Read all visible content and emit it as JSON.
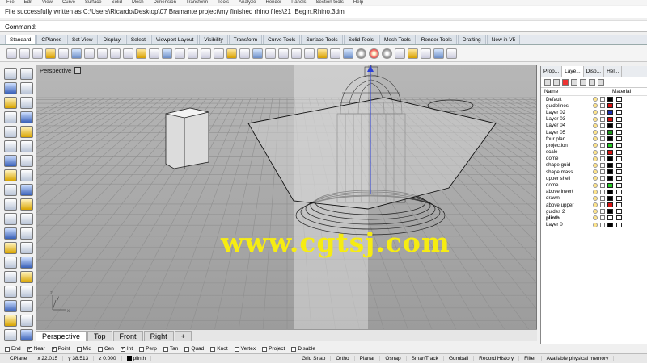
{
  "menu": {
    "items": [
      "File",
      "Edit",
      "View",
      "Curve",
      "Surface",
      "Solid",
      "Mesh",
      "Dimension",
      "Transform",
      "Tools",
      "Analyze",
      "Render",
      "Panels",
      "Section tools",
      "Help"
    ]
  },
  "status_line": "File successfully written as C:\\Users\\Ricardo\\Desktop\\07 Bramante project\\my finished rhino files\\21_Begin.Rhino.3dm",
  "command": {
    "label": "Command:",
    "value": ""
  },
  "toolbar_tabs": [
    "Standard",
    "CPlanes",
    "Set View",
    "Display",
    "Select",
    "Viewport Layout",
    "Visibility",
    "Transform",
    "Curve Tools",
    "Surface Tools",
    "Solid Tools",
    "Mesh Tools",
    "Render Tools",
    "Drafting",
    "New in V5"
  ],
  "toolbar_tab_active": 0,
  "viewport": {
    "label": "Perspective",
    "watermark": "www.cgtsj.com",
    "axis_x": "x",
    "axis_y": "y",
    "axis_z": "z",
    "tabs": [
      "Perspective",
      "Top",
      "Front",
      "Right"
    ],
    "add_tab": "+"
  },
  "panel": {
    "tabs": [
      "Prop...",
      "Laye...",
      "Disp...",
      "Hel..."
    ],
    "active_tab": 1,
    "col_name": "Name",
    "col_material": "Material",
    "layers": [
      {
        "name": "Default",
        "color": "#000000"
      },
      {
        "name": "guidelines",
        "color": "#d81010"
      },
      {
        "name": "Layer 02",
        "color": "#1a2fb0"
      },
      {
        "name": "Layer 03",
        "color": "#cc1010"
      },
      {
        "name": "Layer 04",
        "color": "#000000"
      },
      {
        "name": "Layer 05",
        "color": "#1a9a1a"
      },
      {
        "name": "four plan",
        "color": "#000000"
      },
      {
        "name": "projection",
        "color": "#22cc22"
      },
      {
        "name": "scale",
        "color": "#d81010"
      },
      {
        "name": "dome",
        "color": "#000000"
      },
      {
        "name": "shape guid",
        "color": "#000000"
      },
      {
        "name": "shape mass...",
        "color": "#000000"
      },
      {
        "name": "upper shell",
        "color": "#000000"
      },
      {
        "name": "dome",
        "color": "#22cc22"
      },
      {
        "name": "above invert",
        "color": "#000000"
      },
      {
        "name": "drawn",
        "color": "#000000"
      },
      {
        "name": "above upper",
        "color": "#d81010"
      },
      {
        "name": "guides 2",
        "color": "#000000"
      },
      {
        "name": "plinth",
        "color": "#ffffff",
        "current": true
      },
      {
        "name": "Layer 0",
        "color": "#000000"
      }
    ]
  },
  "osnaps": [
    {
      "label": "End",
      "checked": false
    },
    {
      "label": "Near",
      "checked": true
    },
    {
      "label": "Point",
      "checked": true
    },
    {
      "label": "Mid",
      "checked": false
    },
    {
      "label": "Cen",
      "checked": false
    },
    {
      "label": "Int",
      "checked": true
    },
    {
      "label": "Perp",
      "checked": false
    },
    {
      "label": "Tan",
      "checked": false
    },
    {
      "label": "Quad",
      "checked": false
    },
    {
      "label": "Knot",
      "checked": false
    },
    {
      "label": "Vertex",
      "checked": false
    },
    {
      "label": "Project",
      "checked": false
    },
    {
      "label": "Disable",
      "checked": false
    }
  ],
  "statusbar": {
    "cplane": "CPlane",
    "x": "x 22.015",
    "y": "y 38.513",
    "z": "z 0.000",
    "layer": "plinth",
    "grid_snap": "Grid Snap",
    "ortho": "Ortho",
    "planar": "Planar",
    "osnap": "Osnap",
    "smarttrack": "SmartTrack",
    "gumball": "Gumball",
    "record_history": "Record History",
    "filter": "Filter",
    "memory": "Available physical memory"
  }
}
